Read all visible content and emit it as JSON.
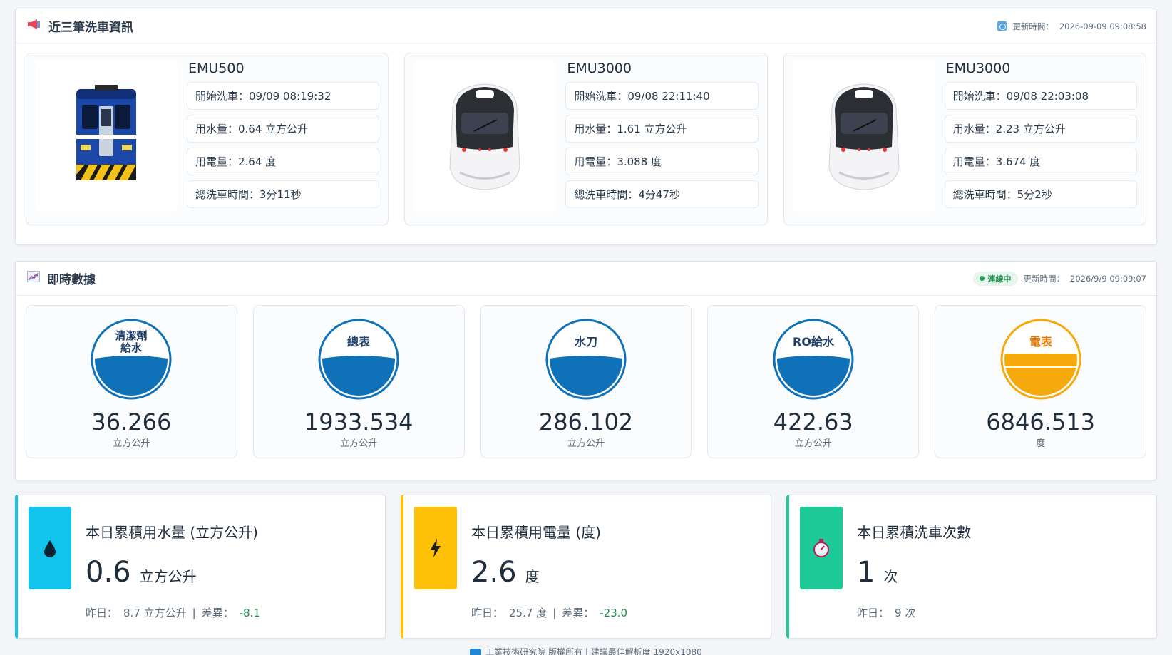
{
  "wash": {
    "title": "近三筆洗車資訊",
    "update_label": "更新時間：",
    "update_time": "2026-09-09 09:08:58",
    "records": [
      {
        "train": "EMU500",
        "start": "開始洗車：09/09 08:19:32",
        "water": "用水量：0.64 立方公升",
        "power": "用電量：2.64 度",
        "duration": "總洗車時間：3分11秒",
        "train_icon": "emu500-train-icon"
      },
      {
        "train": "EMU3000",
        "start": "開始洗車：09/08 22:11:40",
        "water": "用水量：1.61 立方公升",
        "power": "用電量：3.088 度",
        "duration": "總洗車時間：4分47秒",
        "train_icon": "emu3000-train-icon"
      },
      {
        "train": "EMU3000",
        "start": "開始洗車：09/08 22:03:08",
        "water": "用水量：2.23 立方公升",
        "power": "用電量：3.674 度",
        "duration": "總洗車時間：5分2秒",
        "train_icon": "emu3000-train-icon"
      }
    ]
  },
  "realtime": {
    "title": "即時數據",
    "status": "連線中",
    "update_label": "更新時間：",
    "update_time": "2026/9/9 09:09:07",
    "meters": [
      {
        "label_line1": "清潔劑",
        "label_line2": "給水",
        "value": "36.266",
        "unit": "立方公升",
        "color": "#0f72b8"
      },
      {
        "label_line1": "總表",
        "label_line2": "",
        "value": "1933.534",
        "unit": "立方公升",
        "color": "#0f72b8"
      },
      {
        "label_line1": "水刀",
        "label_line2": "",
        "value": "286.102",
        "unit": "立方公升",
        "color": "#0f72b8"
      },
      {
        "label_line1": "RO給水",
        "label_line2": "",
        "value": "422.63",
        "unit": "立方公升",
        "color": "#0f72b8"
      },
      {
        "label_line1": "電表",
        "label_line2": "",
        "value": "6846.513",
        "unit": "度",
        "color": "#f5a90e"
      }
    ]
  },
  "daily": [
    {
      "title": "本日累積用水量 (立方公升)",
      "value": "0.6",
      "unit": "立方公升",
      "yesterday_label": "昨日：",
      "yesterday": "8.7 立方公升",
      "sep": "|",
      "diff_label": "差異：",
      "diff": "-8.1",
      "color": "#12c4ec",
      "icon": "water-drop-icon"
    },
    {
      "title": "本日累積用電量 (度)",
      "value": "2.6",
      "unit": "度",
      "yesterday_label": "昨日：",
      "yesterday": "25.7 度",
      "sep": "|",
      "diff_label": "差異：",
      "diff": "-23.0",
      "color": "#ffc107",
      "icon": "lightning-icon"
    },
    {
      "title": "本日累積洗車次數",
      "value": "1",
      "unit": "次",
      "yesterday_label": "昨日：",
      "yesterday": "9 次",
      "sep": "",
      "diff_label": "",
      "diff": "",
      "color": "#1dc997",
      "icon": "stopwatch-icon"
    }
  ],
  "footer": {
    "text": "工業技術研究院 版權所有 | 建議最佳解析度 1920x1080"
  }
}
